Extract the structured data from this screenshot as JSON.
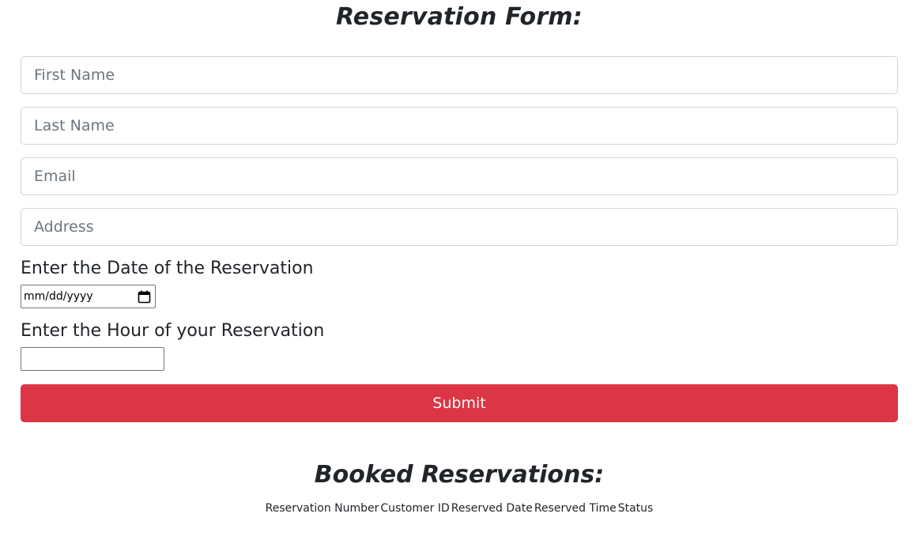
{
  "form": {
    "title": "Reservation Form:",
    "first_name_placeholder": "First Name",
    "last_name_placeholder": "Last Name",
    "email_placeholder": "Email",
    "address_placeholder": "Address",
    "date_label": "Enter the Date of the Reservation",
    "date_placeholder": "mm/dd/yyyy",
    "hour_label": "Enter the Hour of your Reservation",
    "hour_value": "",
    "submit_label": "Submit",
    "submit_color": "#dc3545"
  },
  "booked": {
    "title": "Booked Reservations:",
    "columns": [
      "Reservation Number",
      "Customer ID",
      "Reserved Date",
      "Reserved Time",
      "Status"
    ],
    "rows": []
  },
  "icons": {
    "date_picker": "calendar-icon"
  }
}
